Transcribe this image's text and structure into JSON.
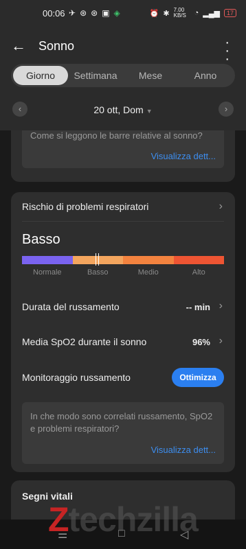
{
  "status": {
    "time": "00:06",
    "network_speed": "7.00 KB/S",
    "battery": "17"
  },
  "header": {
    "title": "Sonno"
  },
  "tabs": [
    {
      "label": "Giorno",
      "active": true
    },
    {
      "label": "Settimana",
      "active": false
    },
    {
      "label": "Mese",
      "active": false
    },
    {
      "label": "Anno",
      "active": false
    }
  ],
  "date": {
    "label": "20 ott, Dom"
  },
  "sleep_bars_help": {
    "question": "Come si leggono le barre relative al sonno?",
    "link": "Visualizza dett..."
  },
  "respiratory": {
    "title": "Rischio di problemi respiratori",
    "level": "Basso",
    "scale_labels": [
      "Normale",
      "Basso",
      "Medio",
      "Alto"
    ],
    "scale_colors": [
      "#7a63f0",
      "#f3a55e",
      "#f3833f",
      "#ee5533"
    ],
    "indicator_position_fraction": 0.37,
    "snoring_duration_label": "Durata del russamento",
    "snoring_duration_value": "-- min",
    "spo2_label": "Media SpO2 durante il sonno",
    "spo2_value": "96%",
    "monitoring_label": "Monitoraggio russamento",
    "optimize_button": "Ottimizza",
    "help_question": "In che modo sono correlati russamento, SpO2 e problemi respiratori?",
    "help_link": "Visualizza dett..."
  },
  "vitals": {
    "title": "Segni vitali"
  },
  "watermark": {
    "brand_z": "Z",
    "brand_text": "techzilla"
  }
}
